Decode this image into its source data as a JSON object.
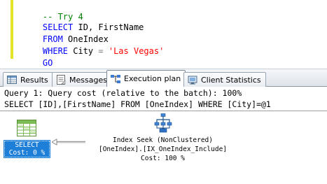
{
  "editor": {
    "lines": [
      {
        "comment": "-- Try 4"
      },
      {
        "kw1": "SELECT",
        "rest": " ID, FirstName"
      },
      {
        "kw1": "FROM",
        "rest": " OneIndex"
      },
      {
        "kw1": "WHERE",
        "rest": " City ",
        "op": "=",
        "str": "'Las Vegas'"
      },
      {
        "kw1": "GO"
      }
    ]
  },
  "tabs": [
    {
      "label": "Results",
      "icon": "results-grid-icon",
      "active": false
    },
    {
      "label": "Messages",
      "icon": "messages-icon",
      "active": false
    },
    {
      "label": "Execution plan",
      "icon": "execution-plan-icon",
      "active": true
    },
    {
      "label": "Client Statistics",
      "icon": "client-statistics-icon",
      "active": false
    }
  ],
  "plan": {
    "query_header": "Query 1: Query cost (relative to the batch): 100%",
    "query_sql": "SELECT [ID],[FirstName] FROM [OneIndex] WHERE [City]=@1",
    "select_node": {
      "title": "SELECT",
      "cost": "Cost: 0 %"
    },
    "seek_node": {
      "title": "Index Seek (NonClustered)",
      "object": "[OneIndex].[IX_OneIndex_Include]",
      "cost": "Cost: 100 %"
    }
  },
  "colors": {
    "keyword": "#0000ff",
    "string": "#ff0000",
    "comment": "#008000",
    "selection": "#1e7fd8",
    "change_bar": "#e3e32a"
  }
}
